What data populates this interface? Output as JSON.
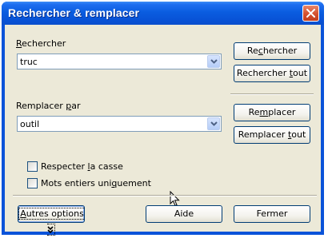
{
  "window": {
    "title": "Rechercher & remplacer"
  },
  "search": {
    "label_prefix": "",
    "label_accel": "R",
    "label_rest": "echercher",
    "value": "truc"
  },
  "replace": {
    "label_prefix": "Remplacer ",
    "label_accel": "p",
    "label_rest": "ar",
    "value": "outil"
  },
  "buttons": {
    "find": {
      "pre": "Re",
      "accel": "c",
      "post": "hercher"
    },
    "find_all": {
      "pre": "Rechercher ",
      "accel": "t",
      "post": "out"
    },
    "replace": {
      "pre": "Re",
      "accel": "m",
      "post": "placer"
    },
    "replace_all": {
      "pre": "Remplacer ",
      "accel": "t",
      "post": "out"
    },
    "more_options": {
      "pre": "",
      "accel": "A",
      "post": "utres options"
    },
    "help": "Aide",
    "close": "Fermer"
  },
  "options": {
    "match_case": {
      "pre": "Respecter ",
      "accel": "l",
      "post": "a casse",
      "checked": false
    },
    "whole_words": {
      "pre": "Mots entiers uni",
      "accel": "q",
      "post": "uement",
      "checked": false
    }
  }
}
